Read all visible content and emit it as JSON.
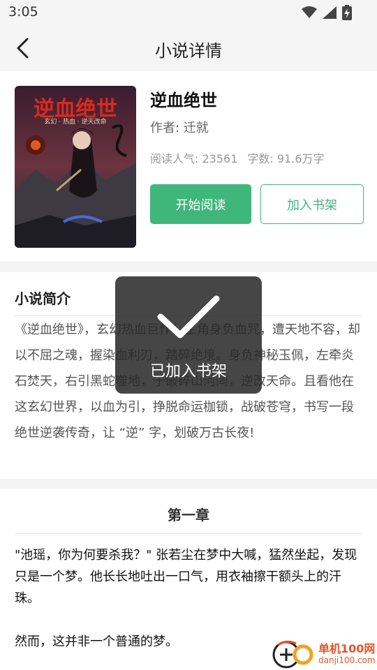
{
  "status_bar": {
    "time": "3:05"
  },
  "app_bar": {
    "title": "小说详情"
  },
  "book": {
    "title": "逆血绝世",
    "author": "作者: 迁就",
    "popularity": "阅读人气: 23561",
    "word_count": "字数: 91.6万字",
    "cover_title": "逆血绝世",
    "cover_subtitle": "玄幻 · 热血 · 逆天改命",
    "read_button": "开始阅读",
    "shelf_button": "加入书架"
  },
  "intro": {
    "heading": "小说简介",
    "text": "《逆血绝世》，玄幻热血巨作！主角身负血咒，遭天地不容，却以不屈之魂，握染血利刃，踏碎绝境。身负神秘玉佩，左牵炎石焚天，右引黑蛇噬地，于破碎山河间，逆改天命。且看他在这玄幻世界，以血为引，挣脱命运枷锁，战破苍穹，书写一段绝世逆袭传奇，让 “逆” 字，划破万古长夜!"
  },
  "chapter": {
    "title": "第一章",
    "paragraphs": [
      "\"池瑶，你为何要杀我？\" 张若尘在梦中大喊，猛然坐起，发现只是一个梦。他长长地吐出一口气，用衣袖擦干额头上的汗珠。",
      "然而，这并非一个普通的梦。"
    ]
  },
  "toast": {
    "text": "已加入书架"
  },
  "watermark": {
    "name": "单机100网",
    "url": "danji100.com"
  },
  "colors": {
    "accent": "#3fb67a",
    "watermark": "#e8542a"
  }
}
